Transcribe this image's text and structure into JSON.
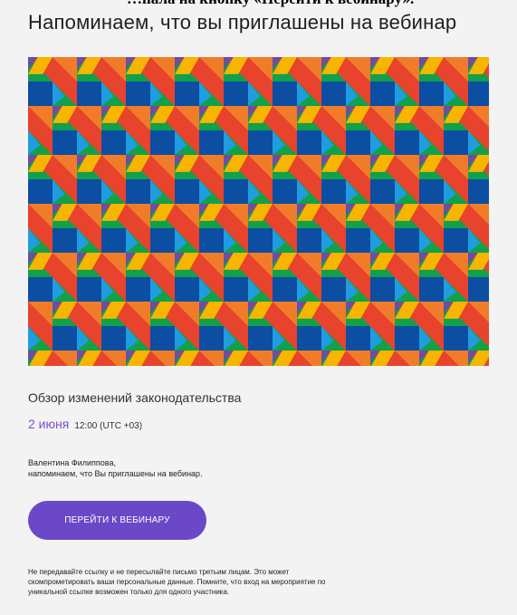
{
  "cutoff_text": "…пала на кнопку «Перейти к вебинару».",
  "header": {
    "title": "Напоминаем, что вы приглашены на вебинар"
  },
  "banner": {
    "colors": {
      "red": "#e8432c",
      "green": "#10a14a",
      "yellow": "#f7b500",
      "orange": "#f07c2a",
      "blue": "#0b4ea2",
      "light_blue": "#1f9de0",
      "purple": "#6b4fa0"
    }
  },
  "event": {
    "title": "Обзор изменений законодательства",
    "date": "2 июня",
    "time": "12:00 (UTC +03)"
  },
  "greeting": {
    "name": "Валентина Филиппова,",
    "message": "напоминаем, что Вы приглашены на вебинар."
  },
  "cta": {
    "label": "ПЕРЕЙТИ К ВЕБИНАРУ",
    "color": "#6b48c8"
  },
  "disclaimer": {
    "line1": "Не передавайте ссылку и не пересылайте письмо третьим лицам. Это может",
    "line2": "скомпрометировать ваши персональные данные. Помните, что вход на мероприятие по",
    "line3": "уникальной ссылке возможен только для одного участника."
  }
}
